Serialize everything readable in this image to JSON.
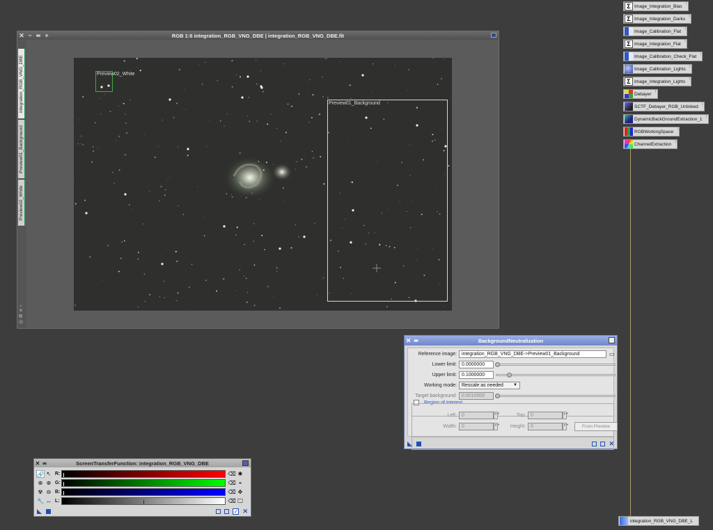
{
  "image_window": {
    "title": "RGB 1:6 integration_RGB_VNG_DBE | integration_RGB_VNG_DBE.fit",
    "tabs": [
      "integration_RGB_VNG_DBE",
      "Preview01_Background",
      "Preview02_White"
    ],
    "previews": {
      "white_label": "Preview02_White",
      "background_label": "Preview01_Background"
    }
  },
  "process_icons": [
    {
      "label": "Image_Integration_Bias",
      "icon": "sigma-icon"
    },
    {
      "label": "Image_Integration_Darks",
      "icon": "sigma-icon"
    },
    {
      "label": "Image_Calibration_Flat",
      "icon": "calibration-icon"
    },
    {
      "label": "Image_Integration_Flat",
      "icon": "sigma-icon"
    },
    {
      "label": "Image_Calibration_Check_Flat",
      "icon": "calibration-icon"
    },
    {
      "label": "Image_Calibration_Lights",
      "icon": "calibration-lights-icon"
    },
    {
      "label": "Image_Integration_Lights",
      "icon": "sigma-icon"
    },
    {
      "label": "Debayer",
      "icon": "debayer-icon"
    },
    {
      "label": "SCTF_Debayer_RGB_Unlinked",
      "icon": "stf-icon"
    },
    {
      "label": "DynamicBackGroundExtraction_1",
      "icon": "dbe-icon"
    },
    {
      "label": "RGBWorkingSpace",
      "icon": "rgb-working-space-icon"
    },
    {
      "label": "ChannelExtraction",
      "icon": "channel-extraction-icon"
    }
  ],
  "bottom_icon": {
    "label": "integration_RGB_VNG_DBE_L"
  },
  "background_neutralization": {
    "title": "BackgroundNeutralization",
    "reference_image_label": "Reference image:",
    "reference_image_value": "integration_RGB_VNG_DBE->Preview01_Background",
    "lower_limit_label": "Lower limit:",
    "lower_limit_value": "0.0000000",
    "upper_limit_label": "Upper limit:",
    "upper_limit_value": "0.1000000",
    "working_mode_label": "Working mode:",
    "working_mode_value": "Rescale as needed",
    "target_background_label": "Target background:",
    "target_background_value": "0.0010000",
    "roi_label": "Region of Interest",
    "left_label": "Left:",
    "left_value": "0",
    "top_label": "Top:",
    "top_value": "0",
    "width_label": "Width:",
    "width_value": "0",
    "height_label": "Height:",
    "height_value": "0",
    "from_preview_label": "From Preview"
  },
  "stf": {
    "title": "ScreenTransferFunction: integration_RGB_VNG_DBE",
    "channels": [
      "R:",
      "G:",
      "B:",
      "L:"
    ]
  },
  "colors": {
    "dialog_title_blue": "#6f86c9",
    "preview_white_box": "#3faa4a",
    "preview_background_box": "#d8d8d8",
    "tab_accent": "#2e8b57"
  }
}
